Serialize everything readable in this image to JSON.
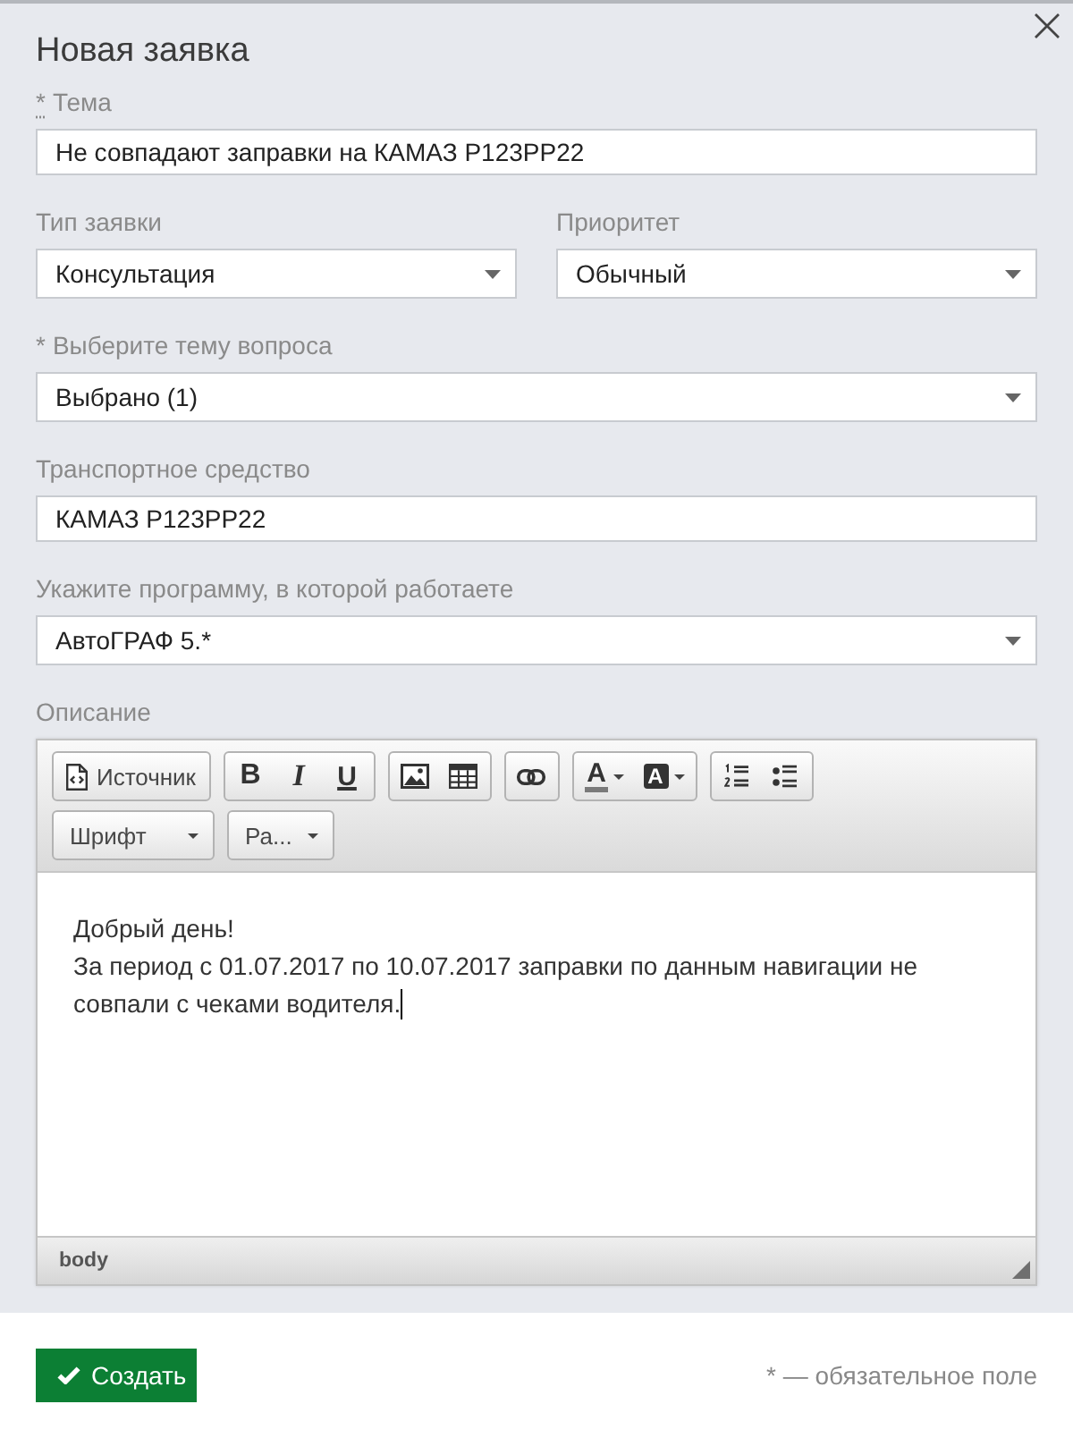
{
  "dialog": {
    "title": "Новая заявка"
  },
  "form_rows": [
    [
      {
        "kind": "input",
        "required_mark": "*",
        "mark_underlined": true,
        "label": "Тема",
        "value": "Не совпадают заправки на КАМАЗ Р123РР22"
      }
    ],
    [
      {
        "kind": "select",
        "label": "Тип заявки",
        "value": "Консультация"
      },
      {
        "kind": "select",
        "label": "Приоритет",
        "value": "Обычный"
      }
    ],
    [
      {
        "kind": "select",
        "required_mark": "*",
        "mark_underlined": false,
        "label": "Выберите тему вопроса",
        "value": "Выбрано (1)"
      }
    ],
    [
      {
        "kind": "input",
        "label": "Транспортное средство",
        "value": "КАМАЗ Р123РР22"
      }
    ],
    [
      {
        "kind": "select",
        "label": "Укажите программу, в которой работаете",
        "value": "АвтоГРАФ 5.*"
      }
    ]
  ],
  "editor": {
    "label": "Описание",
    "toolbar_groups": [
      {
        "buttons": [
          {
            "kind": "source",
            "label": "Источник"
          }
        ]
      },
      {
        "buttons": [
          {
            "kind": "bold",
            "glyph": "B"
          },
          {
            "kind": "italic",
            "glyph": "I"
          },
          {
            "kind": "underline",
            "glyph": "U"
          }
        ]
      },
      {
        "buttons": [
          {
            "kind": "image"
          },
          {
            "kind": "table"
          }
        ]
      },
      {
        "buttons": [
          {
            "kind": "link"
          }
        ]
      },
      {
        "buttons": [
          {
            "kind": "text_color",
            "glyph": "A"
          },
          {
            "kind": "bg_color",
            "glyph": "A"
          }
        ]
      },
      {
        "buttons": [
          {
            "kind": "numbered_list"
          },
          {
            "kind": "bulleted_list"
          }
        ]
      }
    ],
    "toolbar_combos": [
      {
        "kind": "font",
        "label": "Шрифт"
      },
      {
        "kind": "size",
        "label": "Ра..."
      }
    ],
    "paragraphs": [
      "Добрый день!",
      "За период с 01.07.2017 по 10.07.2017 заправки по данным навигации не совпали с чеками водителя."
    ],
    "cursor_visible": true,
    "path": "body"
  },
  "footer": {
    "submit": {
      "label": "Создать"
    },
    "note": "* — обязательное поле"
  }
}
